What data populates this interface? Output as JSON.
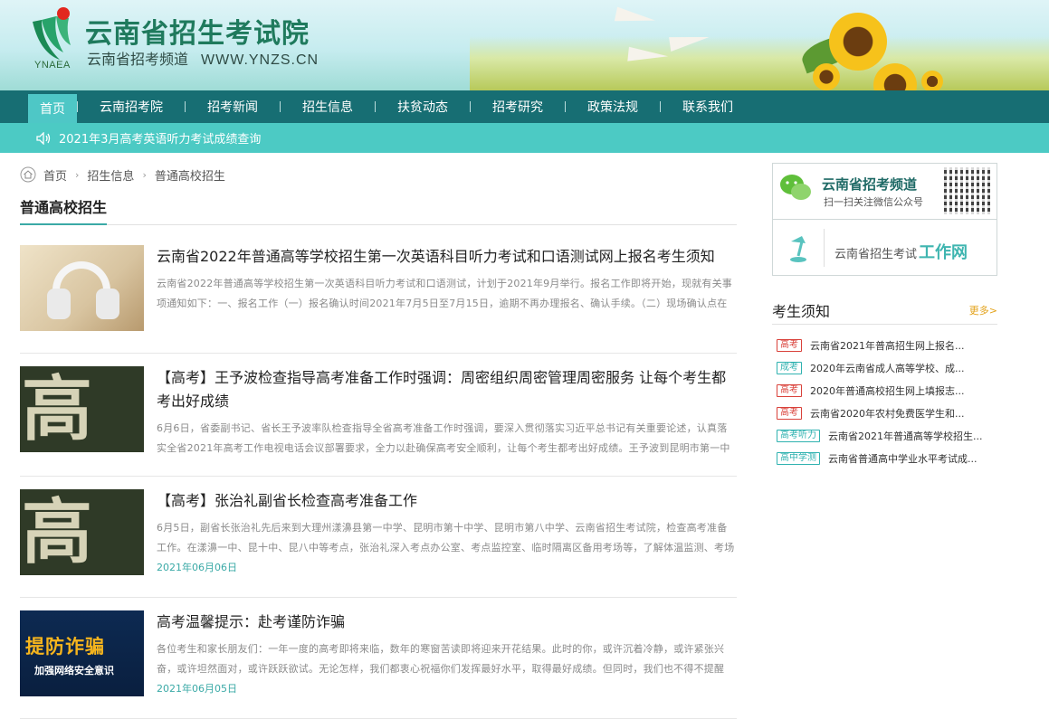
{
  "header": {
    "logo_abbr": "YNAEA",
    "title": "云南省招生考试院",
    "subtitle": "云南省招考频道",
    "url": "WWW.YNZS.CN"
  },
  "nav": {
    "items": [
      {
        "label": "首页",
        "active": true
      },
      {
        "label": "云南招考院"
      },
      {
        "label": "招考新闻"
      },
      {
        "label": "招生信息"
      },
      {
        "label": "扶贫动态"
      },
      {
        "label": "招考研究"
      },
      {
        "label": "政策法规"
      },
      {
        "label": "联系我们"
      }
    ]
  },
  "notice": {
    "text": "2021年3月高考英语听力考试成绩查询",
    "icon": "speaker-icon"
  },
  "breadcrumb": [
    "首页",
    "招生信息",
    "普通高校招生"
  ],
  "section_title": "普通高校招生",
  "articles": [
    {
      "title": "云南省2022年普通高等学校招生第一次英语科目听力考试和口语测试网上报名考生须知",
      "desc": "云南省2022年普通高等学校招生第一次英语科目听力考试和口语测试，计划于2021年9月举行。报名工作即将开始，现就有关事项通知如下：一、报名工作（一）报名确认时间2021年7月5日至7月15日，逾期不再办理报名、确认手续。（二）现场确认点在常住户口所在",
      "date": "",
      "thumb": "headphones"
    },
    {
      "title": "【高考】王予波检查指导高考准备工作时强调：周密组织周密管理周密服务 让每个考生都考出好成绩",
      "desc": "6月6日，省委副书记、省长王予波率队检查指导全省高考准备工作时强调，要深入贯彻落实习近平总书记有关重要论述，认真落实全省2021年高考工作电视电话会议部署要求，全力以赴确保高考安全顺利，让每个考生都考出好成绩。王予波到昆明市第一中学考点，调研",
      "date": "",
      "thumb": "高考"
    },
    {
      "title": "【高考】张治礼副省长检查高考准备工作",
      "desc": "6月5日，副省长张治礼先后来到大理州漾濞县第一中学、昆明市第十中学、昆明市第八中学、云南省招生考试院，检查高考准备工作。在漾濞一中、昆十中、昆八中等考点，张治礼深入考点办公室、考点监控室、临时隔离区备用考场等，了解体温监测、考场布置、试卷",
      "date": "2021年06月06日",
      "thumb": "高考"
    },
    {
      "title": "高考温馨提示：赴考谨防诈骗",
      "desc": "各位考生和家长朋友们：一年一度的高考即将来临，数年的寒窗苦读即将迎来开花结果。此时的你，或许沉着冷静，或许紧张兴奋，或许坦然面对，或许跃跃欲试。无论怎样，我们都衷心祝福你们发挥最好水平，取得最好成绩。但同时，我们也不得不提醒你，在重大考",
      "date": "2021年06月05日",
      "thumb_title": "提防诈骗",
      "thumb_sub": "加强网络安全意识"
    }
  ],
  "sidebar": {
    "wechat": {
      "title": "云南省招考频道",
      "sub": "扫一扫关注微信公众号"
    },
    "work": {
      "prefix": "云南省招生考试",
      "suffix": "工作网"
    },
    "notice_title": "考生须知",
    "more": "更多>",
    "items": [
      {
        "tag": "高考",
        "color": "red",
        "text": "云南省2021年普高招生网上报名..."
      },
      {
        "tag": "成考",
        "color": "teal",
        "text": "2020年云南省成人高等学校、成..."
      },
      {
        "tag": "高考",
        "color": "red",
        "text": "2020年普通高校招生网上填报志..."
      },
      {
        "tag": "高考",
        "color": "red",
        "text": "云南省2020年农村免费医学生和..."
      },
      {
        "tag": "高考听力",
        "color": "teal",
        "text": "云南省2021年普通高等学校招生..."
      },
      {
        "tag": "高中学测",
        "color": "teal",
        "text": "云南省普通高中学业水平考试成..."
      }
    ]
  }
}
